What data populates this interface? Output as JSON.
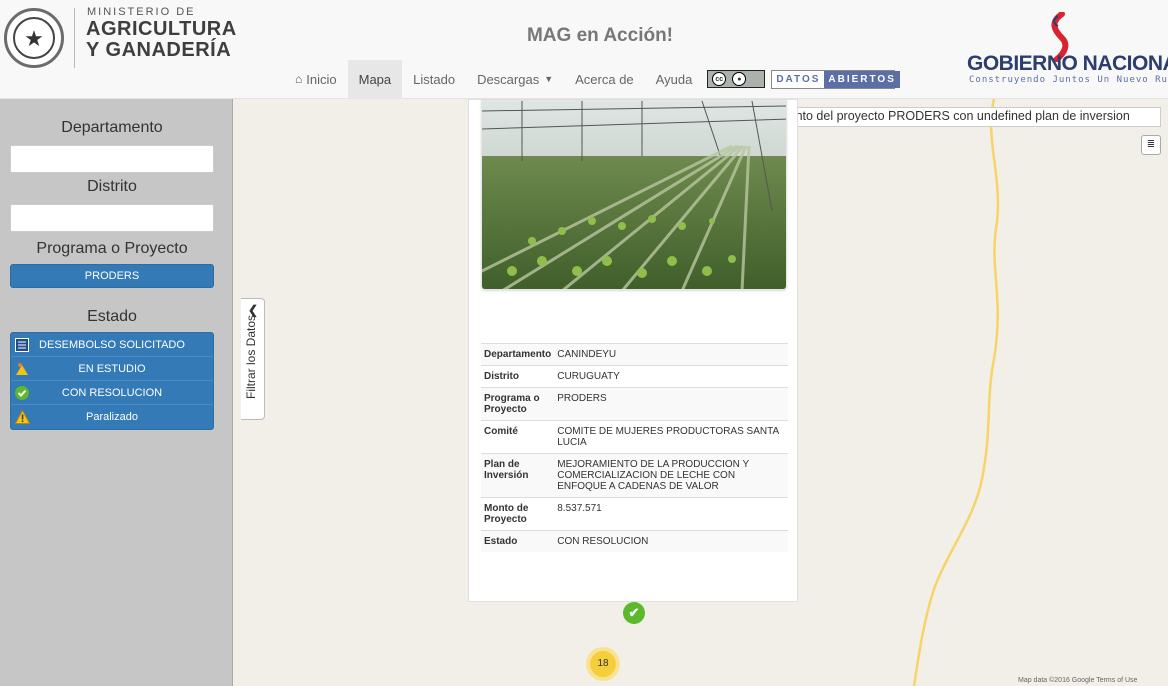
{
  "header": {
    "ministry_top": "MINISTERIO DE",
    "ministry_line1": "AGRICULTURA",
    "ministry_line2": "Y GANADERÍA",
    "app_title": "MAG en Acción!",
    "gob_name": "GOBIERNO NACIONAL",
    "gob_slogan": "Construyendo Juntos Un Nuevo Rumbo",
    "datos_part1": "DATOS",
    "datos_part2": "ABIERTOS",
    "cc_label": "cc"
  },
  "nav": {
    "items": [
      {
        "label": "Inicio",
        "icon": "home-icon"
      },
      {
        "label": "Mapa",
        "active": true
      },
      {
        "label": "Listado"
      },
      {
        "label": "Descargas"
      },
      {
        "label": "Acerca de"
      },
      {
        "label": "Ayuda"
      }
    ]
  },
  "sidebar": {
    "departamento_label": "Departamento",
    "departamento_value": "",
    "distrito_label": "Distrito",
    "distrito_value": "",
    "programa_label": "Programa o Proyecto",
    "programa_button": "PRODERS",
    "estado_label": "Estado",
    "estado_items": [
      {
        "label": "DESEMBOLSO SOLICITADO",
        "icon": "list-icon"
      },
      {
        "label": "EN ESTUDIO",
        "icon": "study-icon"
      },
      {
        "label": "CON RESOLUCION",
        "icon": "check-icon"
      },
      {
        "label": "Paralizado",
        "icon": "warning-icon"
      }
    ]
  },
  "map": {
    "filter_tab_label": "Filtrar los Datos",
    "status_message": "Mostrando un asentamiento del proyecto PRODERS con undefined plan de inversion",
    "cluster_count": "18",
    "attribution": "Map data ©2016 Google    Terms of Use"
  },
  "info": {
    "rows": [
      {
        "key": "Departamento",
        "value": "CANINDEYU"
      },
      {
        "key": "Distrito",
        "value": "CURUGUATY"
      },
      {
        "key": "Programa o Proyecto",
        "value": "PRODERS"
      },
      {
        "key": "Comité",
        "value": "COMITE DE MUJERES PRODUCTORAS SANTA LUCIA"
      },
      {
        "key": "Plan de Inversión",
        "value": "MEJORAMIENTO DE LA PRODUCCION Y COMERCIALIZACION DE LECHE CON ENFOQUE A CADENAS DE VALOR"
      },
      {
        "key": "Monto de Proyecto",
        "value": "8.537.571"
      },
      {
        "key": "Estado",
        "value": "CON RESOLUCION"
      }
    ]
  },
  "colors": {
    "primary": "#337ab7",
    "sidebar_bg": "#c6c6c6",
    "map_bg": "#f2efe9",
    "road": "#f7d36a",
    "marker_green": "#5cb82d",
    "cluster_yellow": "#f5cf3b"
  }
}
